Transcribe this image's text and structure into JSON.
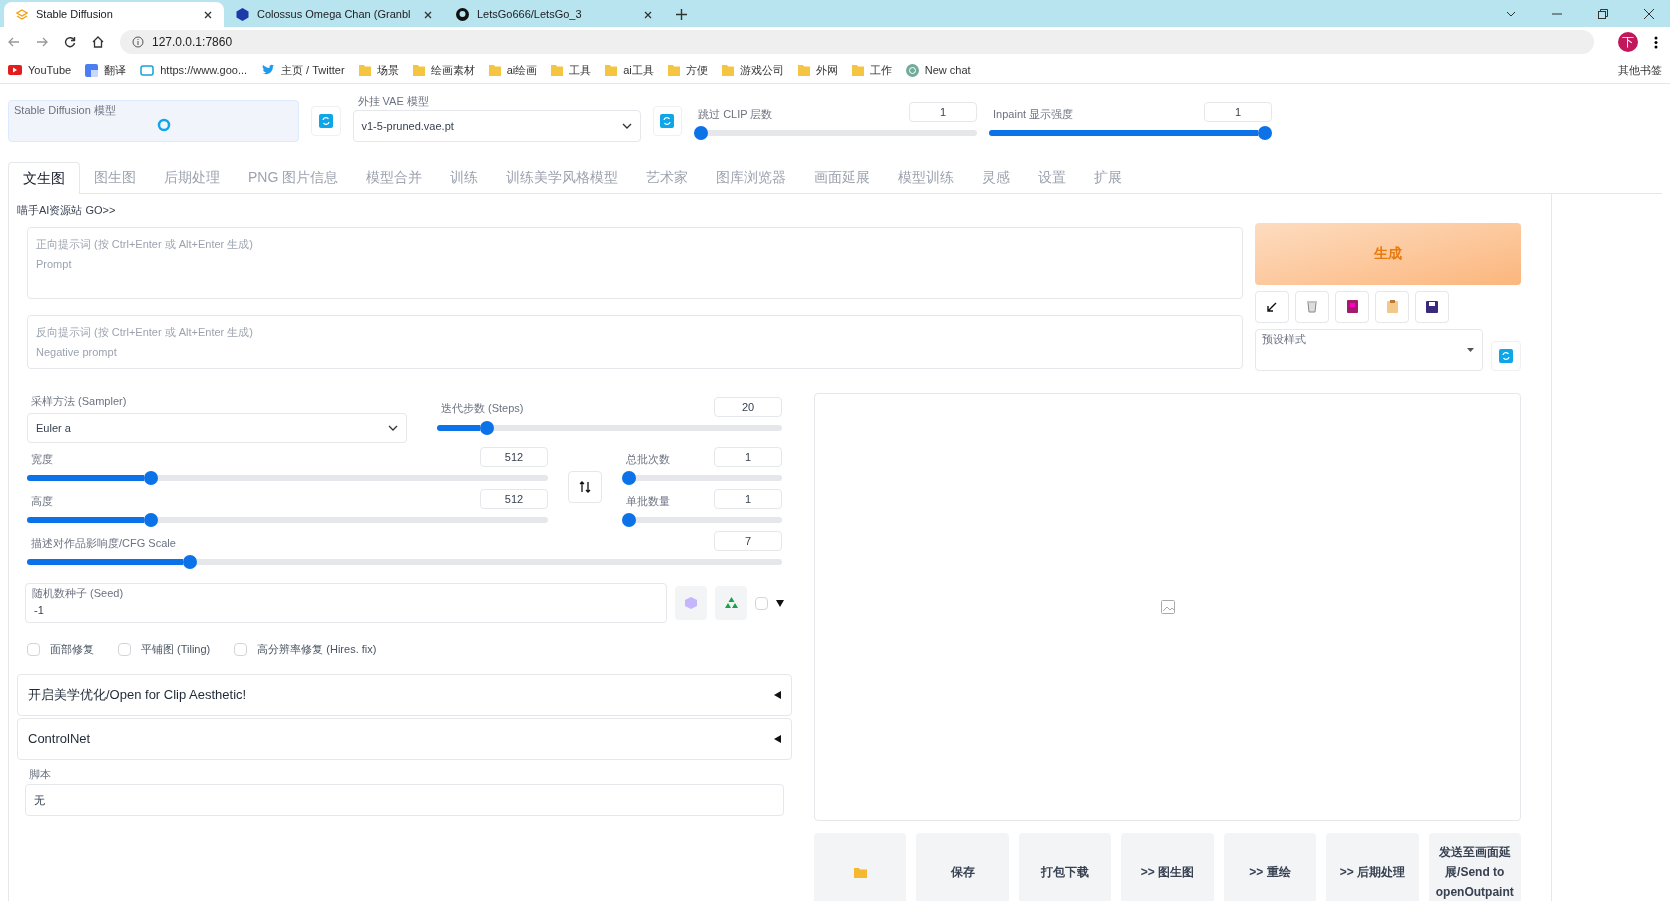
{
  "browser": {
    "tabs": [
      {
        "title": "Stable Diffusion",
        "selected": true
      },
      {
        "title": "Colossus Omega Chan (Granbl",
        "selected": false
      },
      {
        "title": "LetsGo666/LetsGo_3",
        "selected": false
      }
    ],
    "address": "127.0.0.1:7860",
    "profile": "下",
    "bookmarks": [
      {
        "label": "YouTube",
        "kind": "yt"
      },
      {
        "label": "翻译",
        "kind": "tr"
      },
      {
        "label": "https://www.goo...",
        "kind": "tv"
      },
      {
        "label": "主页 / Twitter",
        "kind": "tw"
      },
      {
        "label": "场景",
        "kind": "folder"
      },
      {
        "label": "绘画素材",
        "kind": "folder"
      },
      {
        "label": "ai绘画",
        "kind": "folder"
      },
      {
        "label": "工具",
        "kind": "folder"
      },
      {
        "label": "ai工具",
        "kind": "folder"
      },
      {
        "label": "方便",
        "kind": "folder"
      },
      {
        "label": "游戏公司",
        "kind": "folder"
      },
      {
        "label": "外网",
        "kind": "folder"
      },
      {
        "label": "工作",
        "kind": "folder"
      },
      {
        "label": "New chat",
        "kind": "chat"
      }
    ],
    "other_bookmarks": "其他书签"
  },
  "top": {
    "model_label": "Stable Diffusion 模型",
    "vae_label": "外挂 VAE 模型",
    "vae_value": "v1-5-pruned.vae.pt",
    "clip": {
      "label": "跳过 CLIP 层数",
      "value": "1",
      "level": 0
    },
    "inpaint": {
      "label": "Inpaint 显示强度",
      "value": "1",
      "level": 1
    }
  },
  "tabs": [
    {
      "label": "文生图",
      "selected": true
    },
    {
      "label": "图生图",
      "selected": false
    },
    {
      "label": "后期处理",
      "selected": false
    },
    {
      "label": "PNG 图片信息",
      "selected": false
    },
    {
      "label": "模型合并",
      "selected": false
    },
    {
      "label": "训练",
      "selected": false
    },
    {
      "label": "训练美学风格模型",
      "selected": false
    },
    {
      "label": "艺术家",
      "selected": false
    },
    {
      "label": "图库浏览器",
      "selected": false
    },
    {
      "label": "画面延展",
      "selected": false
    },
    {
      "label": "模型训练",
      "selected": false
    },
    {
      "label": "灵感",
      "selected": false
    },
    {
      "label": "设置",
      "selected": false
    },
    {
      "label": "扩展",
      "selected": false
    }
  ],
  "link": "喵手AI资源站 GO>>",
  "prompt": {
    "placeholder_1": "正向提示词 (按 Ctrl+Enter 或 Alt+Enter 生成)",
    "placeholder_2": "Prompt"
  },
  "negative_prompt": {
    "placeholder_1": "反向提示词 (按 Ctrl+Enter 或 Alt+Enter 生成)",
    "placeholder_2": "Negative prompt"
  },
  "generate": "生成",
  "styles_label": "预设样式",
  "sampler": {
    "label": "采样方法 (Sampler)",
    "value": "Euler a"
  },
  "steps": {
    "label": "迭代步数 (Steps)",
    "value": "20",
    "level": 0.13
  },
  "width": {
    "label": "宽度",
    "value": "512",
    "level": 0.23
  },
  "height": {
    "label": "高度",
    "value": "512",
    "level": 0.23
  },
  "batch_count": {
    "label": "总批次数",
    "value": "1",
    "level": 0
  },
  "batch_size": {
    "label": "单批数量",
    "value": "1",
    "level": 0
  },
  "cfg": {
    "label": "描述对作品影响度/CFG Scale",
    "value": "7",
    "level": 0.21
  },
  "seed": {
    "label": "随机数种子 (Seed)",
    "value": "-1",
    "extra_checked": false
  },
  "options": [
    {
      "label": "面部修复",
      "checked": false
    },
    {
      "label": "平铺图 (Tiling)",
      "checked": false
    },
    {
      "label": "高分辨率修复 (Hires. fix)",
      "checked": false
    }
  ],
  "accordions": [
    {
      "title": "开启美学优化/Open for Clip Aesthetic!",
      "expanded": false
    },
    {
      "title": "ControlNet",
      "expanded": false
    }
  ],
  "script": {
    "label": "脚本",
    "value": "无"
  },
  "output_buttons": [
    {
      "kind": "folder"
    },
    {
      "kind": "text",
      "label": "保存"
    },
    {
      "kind": "text",
      "label": "打包下载"
    },
    {
      "kind": "text",
      "label": ">> 图生图"
    },
    {
      "kind": "text",
      "label": ">> 重绘"
    },
    {
      "kind": "text",
      "label": ">> 后期处理"
    },
    {
      "kind": "text",
      "label": "发送至画面延展/Send to openOutpaint"
    }
  ]
}
